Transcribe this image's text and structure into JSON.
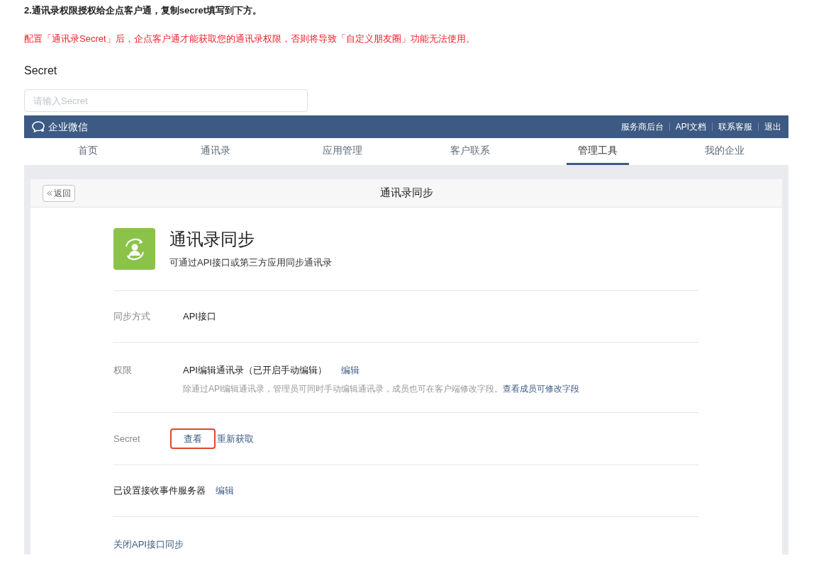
{
  "step_title": "2.通讯录权限授权给企点客户通，复制secret填写到下方。",
  "warning": "配置「通讯录Secret」后，企点客户通才能获取您的通讯录权限，否则将导致「自定义朋友圈」功能无法使用。",
  "secret_field": {
    "label": "Secret",
    "placeholder": "请输入Secret"
  },
  "screenshot": {
    "brand": "企业微信",
    "top_links": [
      "服务商后台",
      "API文档",
      "联系客服",
      "退出"
    ],
    "tabs": [
      {
        "label": "首页",
        "selected": false
      },
      {
        "label": "通讯录",
        "selected": false
      },
      {
        "label": "应用管理",
        "selected": false
      },
      {
        "label": "客户联系",
        "selected": false
      },
      {
        "label": "管理工具",
        "selected": true
      },
      {
        "label": "我的企业",
        "selected": false
      }
    ],
    "back_button": "返回",
    "page_title": "通讯录同步",
    "app": {
      "name": "通讯录同步",
      "description": "可通过API接口或第三方应用同步通讯录"
    },
    "sync_method": {
      "label": "同步方式",
      "value": "API接口"
    },
    "permission": {
      "label": "权限",
      "value": "API编辑通讯录（已开启手动编辑）",
      "edit_link": "编辑",
      "note": "除通过API编辑通讯录，管理员可同时手动编辑通讯录，成员也可在客户端修改字段。",
      "note_link": "查看成员可修改字段"
    },
    "secret": {
      "label": "Secret",
      "actions": [
        {
          "label": "查看",
          "highlighted": true
        },
        {
          "label": "重新获取",
          "highlighted": false
        }
      ]
    },
    "event_server": {
      "label": "已设置接收事件服务器",
      "edit_link": "编辑"
    },
    "close_link": "关闭API接口同步"
  }
}
